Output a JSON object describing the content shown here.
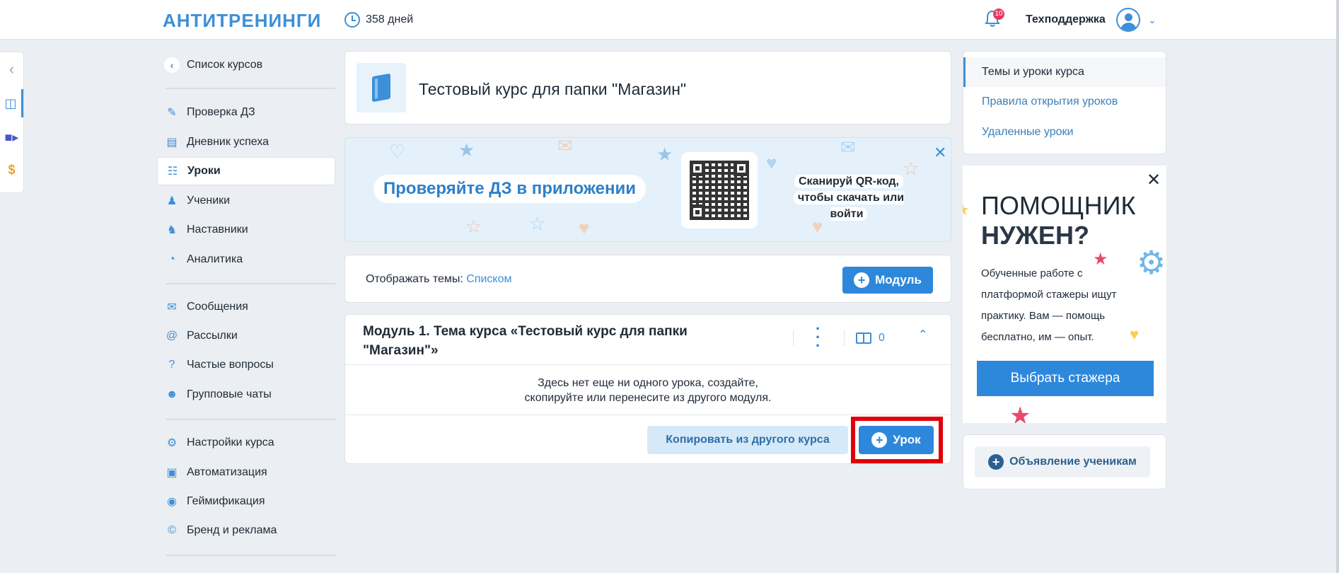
{
  "header": {
    "logo": "АНТИТРЕНИНГИ",
    "days": "358 дней",
    "notifications_count": "10",
    "support_label": "Техподдержка"
  },
  "sidebar": {
    "back_label": "Список курсов",
    "groups": [
      [
        {
          "label": "Проверка ДЗ",
          "icon": "edit-icon"
        },
        {
          "label": "Дневник успеха",
          "icon": "diary-icon"
        },
        {
          "label": "Уроки",
          "icon": "book-icon",
          "active": true
        },
        {
          "label": "Ученики",
          "icon": "students-icon"
        },
        {
          "label": "Наставники",
          "icon": "mentors-icon"
        },
        {
          "label": "Аналитика",
          "icon": "pie-chart-icon"
        }
      ],
      [
        {
          "label": "Сообщения",
          "icon": "chat-icon"
        },
        {
          "label": "Рассылки",
          "icon": "at-icon"
        },
        {
          "label": "Частые вопросы",
          "icon": "question-icon"
        },
        {
          "label": "Групповые чаты",
          "icon": "group-chat-icon"
        }
      ],
      [
        {
          "label": "Настройки курса",
          "icon": "gear-icon"
        },
        {
          "label": "Автоматизация",
          "icon": "robot-icon"
        },
        {
          "label": "Геймификация",
          "icon": "gamepad-icon"
        },
        {
          "label": "Бренд и реклама",
          "icon": "copyright-icon"
        }
      ]
    ]
  },
  "course": {
    "title": "Тестовый курс для папки \"Магазин\""
  },
  "banner": {
    "headline": "Проверяйте ДЗ в приложении",
    "scan_line1": "Сканируй QR-код,",
    "scan_line2": "чтобы скачать или войти"
  },
  "display": {
    "label": "Отображать темы:",
    "value": "Списком",
    "add_module_label": "Модуль"
  },
  "module": {
    "title": "Модуль 1. Тема курса «Тестовый курс для папки \"Магазин\"»",
    "lessons_count": "0",
    "empty_line1": "Здесь нет еще ни одного урока, создайте,",
    "empty_line2": "скопируйте или перенесите из другого модуля.",
    "copy_button": "Копировать из другого курса",
    "add_lesson_button": "Урок"
  },
  "right_nav": {
    "items": [
      {
        "label": "Темы и уроки курса",
        "active": true
      },
      {
        "label": "Правила открытия уроков"
      },
      {
        "label": "Удаленные уроки"
      }
    ]
  },
  "ad": {
    "title_line1": "ПОМОЩНИК",
    "title_line2": "НУЖЕН?",
    "text": "Обученные работе с платформой стажеры ищут практику. Вам — помощь бесплатно, им — опыт.",
    "button": "Выбрать стажера"
  },
  "announce": {
    "button": "Объявление ученикам"
  },
  "colors": {
    "accent": "#2d88db",
    "highlight": "#e0000a",
    "background": "#ebeef2"
  }
}
